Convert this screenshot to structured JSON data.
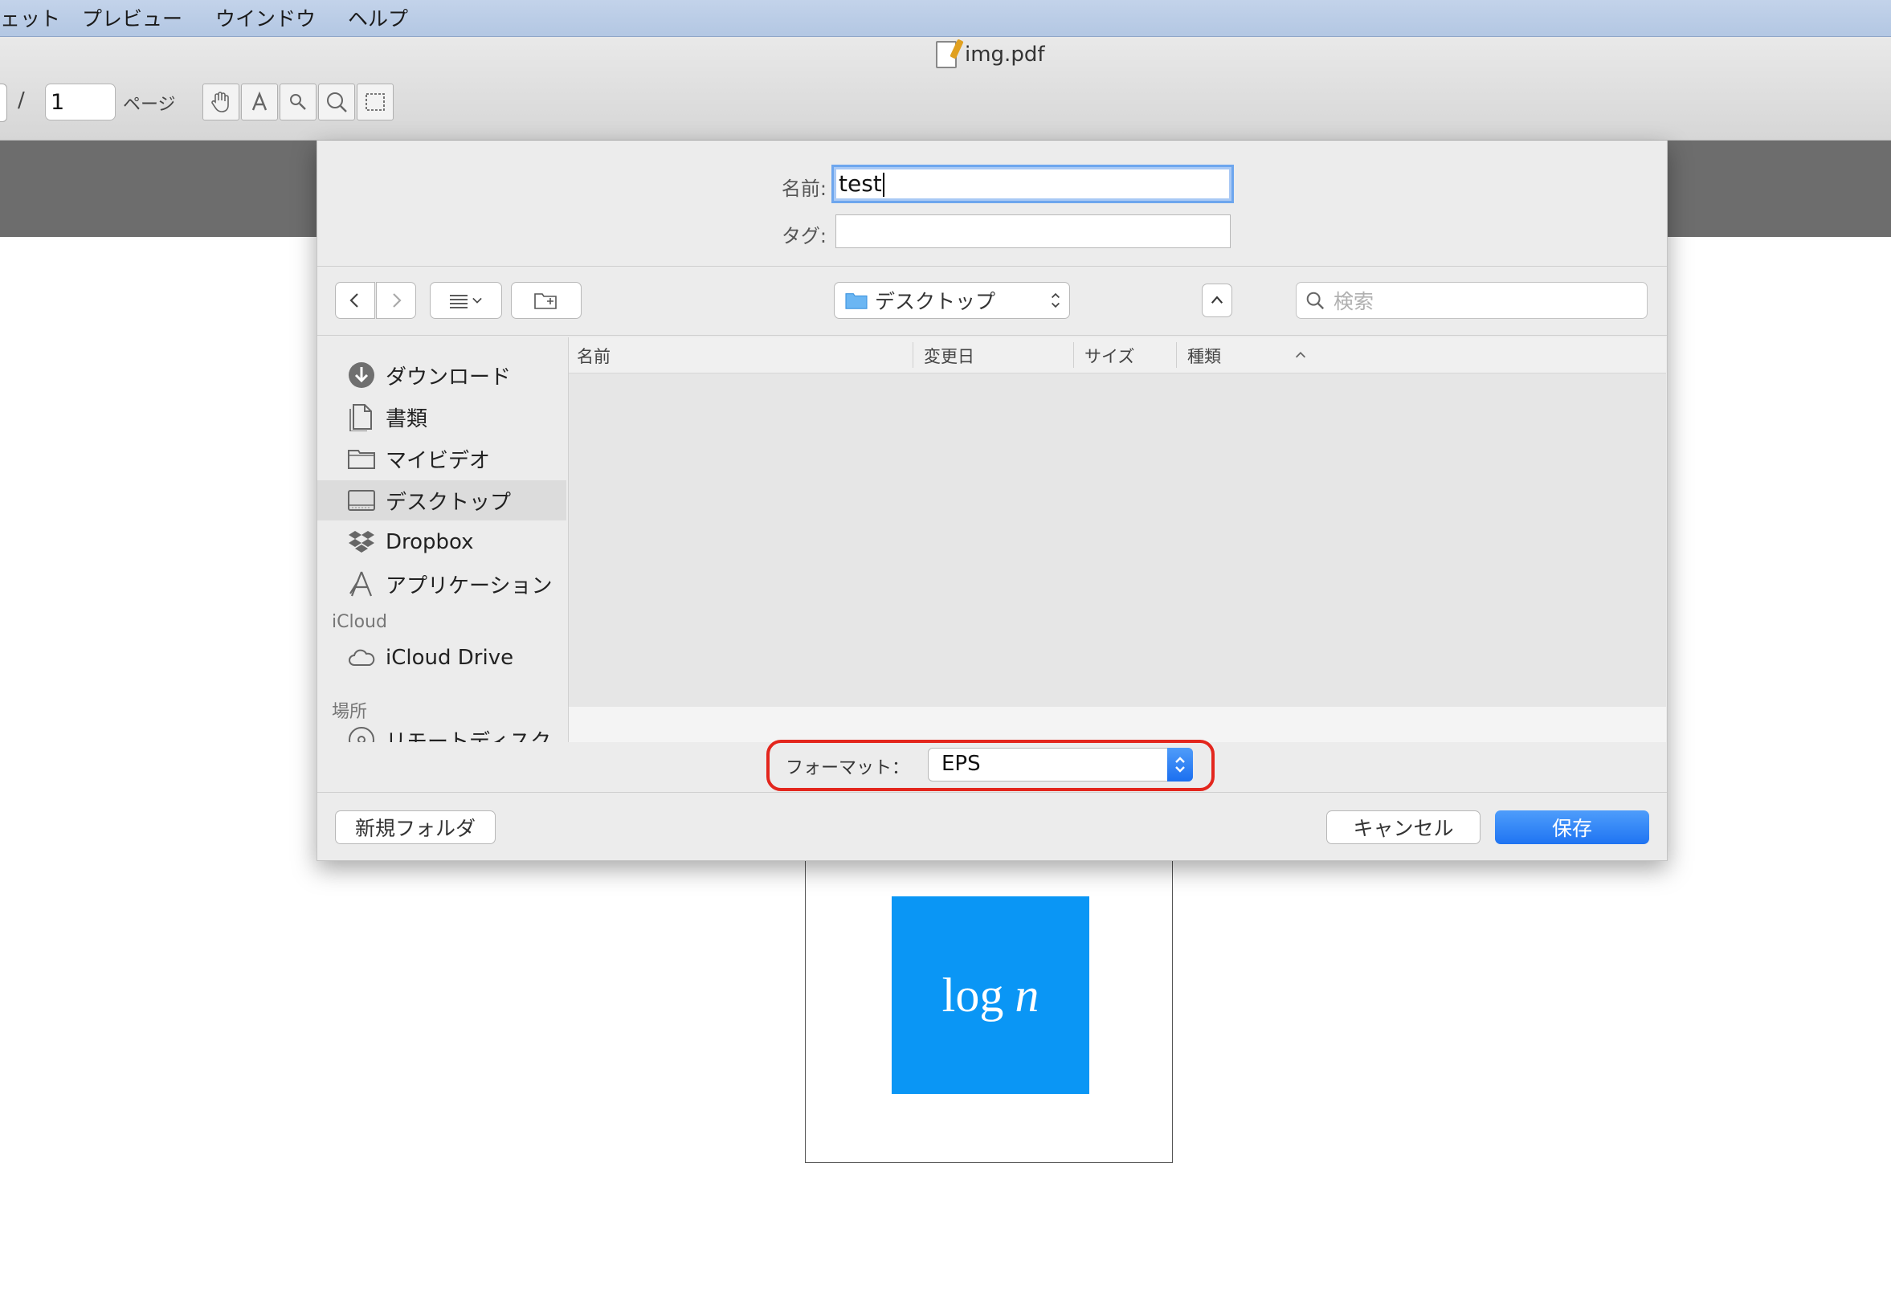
{
  "menubar": {
    "items": [
      "ェット",
      "プレビュー",
      "ウインドウ",
      "ヘルプ"
    ]
  },
  "window": {
    "title": "img.pdf",
    "page_number": "1",
    "page_label": "ページ"
  },
  "document": {
    "math_text": "log",
    "math_var": "n",
    "box_color": "#0a96f5"
  },
  "save_dialog": {
    "name_label": "名前:",
    "name_value": "test",
    "tags_label": "タグ:",
    "tags_value": "",
    "location": "デスクトップ",
    "search_placeholder": "検索",
    "sidebar": {
      "favorites": [
        {
          "label": "ダウンロード",
          "icon": "download-icon"
        },
        {
          "label": "書類",
          "icon": "document-icon"
        },
        {
          "label": "マイビデオ",
          "icon": "folder-icon"
        },
        {
          "label": "デスクトップ",
          "icon": "desktop-icon",
          "selected": true
        },
        {
          "label": "Dropbox",
          "icon": "dropbox-icon"
        },
        {
          "label": "アプリケーション",
          "icon": "applications-icon"
        }
      ],
      "icloud_header": "iCloud",
      "icloud_items": [
        {
          "label": "iCloud Drive",
          "icon": "cloud-icon"
        }
      ],
      "places_header": "場所",
      "places_items": [
        {
          "label": "リモートディスク",
          "icon": "disc-icon"
        }
      ]
    },
    "columns": [
      "名前",
      "変更日",
      "サイズ",
      "種類"
    ],
    "sort_column": "変更日",
    "format_label": "フォーマット：",
    "format_value": "EPS",
    "new_folder_label": "新規フォルダ",
    "cancel_label": "キャンセル",
    "save_label": "保存",
    "accent_color": "#1f74f2",
    "highlight_color": "#e3261d"
  }
}
